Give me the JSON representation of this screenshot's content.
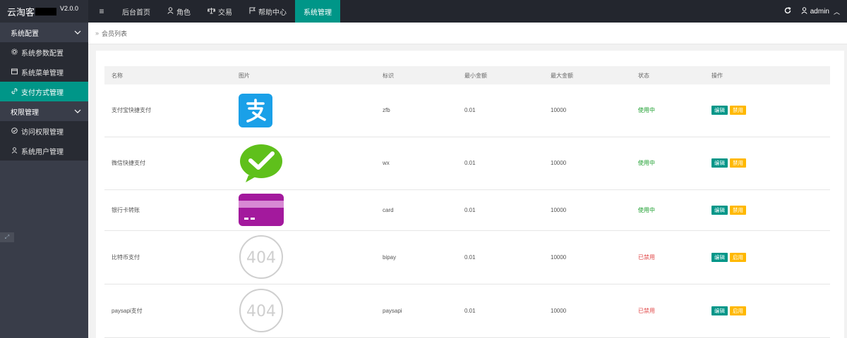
{
  "app": {
    "title": "云淘客",
    "version": "V2.0.0"
  },
  "topnav": {
    "toggle_glyph": "≡",
    "items": [
      {
        "label": "后台首页",
        "icon": ""
      },
      {
        "label": "角色",
        "icon": "person-icon"
      },
      {
        "label": "交易",
        "icon": "scale-icon"
      },
      {
        "label": "帮助中心",
        "icon": "flag-icon"
      },
      {
        "label": "系统管理",
        "icon": ""
      }
    ],
    "active_index": 4,
    "user": "admin"
  },
  "sidebar": {
    "groups": [
      {
        "label": "系统配置",
        "items": [
          {
            "label": "系统参数配置",
            "icon": "gear-icon"
          },
          {
            "label": "系统菜单管理",
            "icon": "window-icon"
          },
          {
            "label": "支付方式管理",
            "icon": "link-icon",
            "active": true
          }
        ]
      },
      {
        "label": "权限管理",
        "items": [
          {
            "label": "访问权限管理",
            "icon": "check-circle-icon"
          },
          {
            "label": "系统用户管理",
            "icon": "person-icon"
          }
        ]
      }
    ]
  },
  "breadcrumb": "会员列表",
  "table": {
    "headers": [
      "名称",
      "图片",
      "标识",
      "最小金额",
      "最大金额",
      "状态",
      "操作"
    ],
    "rows": [
      {
        "name": "支付宝快捷支付",
        "image": "alipay-logo",
        "code": "zfb",
        "min": "0.01",
        "max": "10000",
        "status": "使用中",
        "edit": "编辑",
        "toggle": "禁用"
      },
      {
        "name": "微信快捷支付",
        "image": "wechat-logo",
        "code": "wx",
        "min": "0.01",
        "max": "10000",
        "status": "使用中",
        "edit": "编辑",
        "toggle": "禁用"
      },
      {
        "name": "银行卡转账",
        "image": "bank-card-logo",
        "code": "card",
        "min": "0.01",
        "max": "10000",
        "status": "使用中",
        "edit": "编辑",
        "toggle": "禁用"
      },
      {
        "name": "比特币支付",
        "image": "404-placeholder",
        "image_text": "404",
        "code": "bipay",
        "min": "0.01",
        "max": "10000",
        "status": "已禁用",
        "edit": "编辑",
        "toggle": "启用"
      },
      {
        "name": "paysapi支付",
        "image": "404-placeholder",
        "image_text": "404",
        "code": "paysapi",
        "min": "0.01",
        "max": "10000",
        "status": "已禁用",
        "edit": "编辑",
        "toggle": "启用"
      }
    ]
  },
  "colors": {
    "accent": "#009688",
    "warn": "#ffb800",
    "status_on": "#1b9e2d",
    "status_off": "#e24b4b",
    "alipay": "#1aa0e8",
    "wechat": "#5fc01b",
    "bank": "#a3199d"
  }
}
